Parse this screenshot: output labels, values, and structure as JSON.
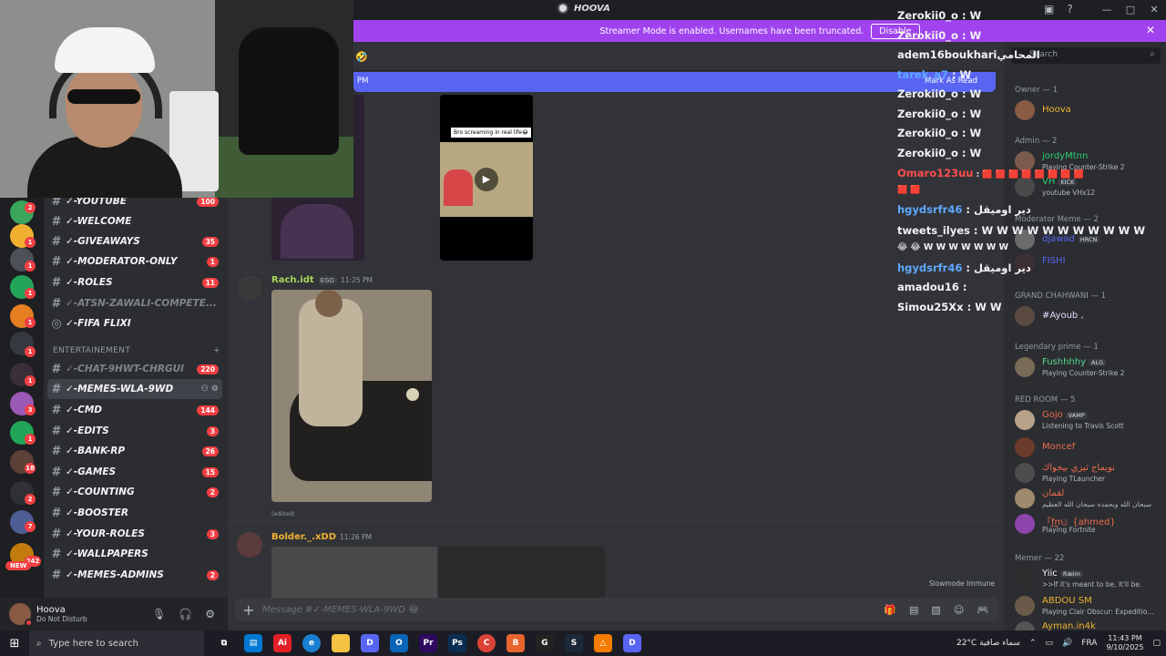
{
  "window": {
    "title": "HOOVA",
    "controls": [
      "—",
      "□",
      "✕"
    ],
    "top_icons": [
      "inbox-icon",
      "help-icon"
    ]
  },
  "banner": {
    "text": "Streamer Mode is enabled. Usernames have been truncated.",
    "button": "Disable",
    "close": "✕",
    "color": "#a043ee"
  },
  "servers": {
    "new_label": "NEW",
    "badges": [
      "2",
      "1",
      "1",
      "1",
      "1",
      "1",
      "1",
      "1",
      "3",
      "1",
      "18",
      "2",
      "7",
      "242"
    ]
  },
  "channels": [
    {
      "name": "✓-YOUTUBE",
      "badge": "100",
      "selected": false,
      "dim": false
    },
    {
      "name": "✓-WELCOME",
      "badge": "",
      "selected": false,
      "dim": false
    },
    {
      "name": "✓-GIVEAWAYS",
      "badge": "35",
      "selected": false,
      "dim": false
    },
    {
      "name": "✓-MODERATOR-ONLY",
      "badge": "1",
      "selected": false,
      "dim": false
    },
    {
      "name": "✓-ROLES",
      "badge": "11",
      "selected": false,
      "dim": false
    },
    {
      "name": "✓-ATSN-ZAWALI-COMPETE...",
      "badge": "",
      "selected": false,
      "dim": true
    },
    {
      "name": "✓-FIFA FLIXI",
      "badge": "",
      "selected": false,
      "dim": false
    },
    {
      "name": "✓-CHAT-9HWT-CHRGUI",
      "badge": "220",
      "selected": false,
      "dim": true
    },
    {
      "name": "✓-MEMES-WLA-9WD",
      "badge": "",
      "selected": true,
      "dim": false
    },
    {
      "name": "✓-CMD",
      "badge": "144",
      "selected": false,
      "dim": false
    },
    {
      "name": "✓-EDITS",
      "badge": "3",
      "selected": false,
      "dim": false
    },
    {
      "name": "✓-BANK-RP",
      "badge": "26",
      "selected": false,
      "dim": false
    },
    {
      "name": "✓-GAMES",
      "badge": "15",
      "selected": false,
      "dim": false
    },
    {
      "name": "✓-COUNTING",
      "badge": "2",
      "selected": false,
      "dim": false
    },
    {
      "name": "✓-BOOSTER",
      "badge": "",
      "selected": false,
      "dim": false
    },
    {
      "name": "✓-YOUR-ROLES",
      "badge": "3",
      "selected": false,
      "dim": false
    },
    {
      "name": "✓-WALLPAPERS",
      "badge": "",
      "selected": false,
      "dim": false
    },
    {
      "name": "✓-MEMES-ADMINS",
      "badge": "2",
      "selected": false,
      "dim": false
    }
  ],
  "category": {
    "name": "ENTERTAINEMENT",
    "add": "+"
  },
  "user": {
    "name": "Hoova",
    "status": "Do Not Disturb"
  },
  "main": {
    "new_messages_prefix": "PM",
    "mark_as_read": "Mark As Read",
    "video_caption": "Bro screaming in real life😂",
    "messages": [
      {
        "author": "Rach.idt",
        "tag": "EGO",
        "time": "11:25 PM",
        "edited": "(edited)"
      },
      {
        "author": "Bolder._.xDD",
        "tag": "",
        "time": "11:26 PM"
      }
    ],
    "slowmode": "Slowmode Immune"
  },
  "composer": {
    "placeholder": "Message #✓-MEMES-WLA-9WD 😂"
  },
  "stream_chat": [
    {
      "user": "Zerokii0_o",
      "text": "W",
      "color": "white"
    },
    {
      "user": "Zerokii0_o",
      "text": "W",
      "color": "white"
    },
    {
      "user": "adem16boukhari",
      "text": "المحامي",
      "color": "white"
    },
    {
      "user": "tarek_a7",
      "text": "W",
      "color": "blue"
    },
    {
      "user": "Zerokii0_o",
      "text": "W",
      "color": "white"
    },
    {
      "user": "Zerokii0_o",
      "text": "W",
      "color": "white"
    },
    {
      "user": "Zerokii0_o",
      "text": "W",
      "color": "white"
    },
    {
      "user": "Zerokii0_o",
      "text": "W",
      "color": "white"
    },
    {
      "user": "Omaro123uu",
      "text": "🟥 🟥 🟥 🟥 🟥 🟥 🟥 🟥",
      "color": "red"
    },
    {
      "user": "",
      "text": "🟥 🟥",
      "color": "white"
    },
    {
      "user": "hgydsrfr46",
      "text": "دير اوميقل",
      "color": "blue"
    },
    {
      "user": "tweets_ilyes",
      "text": "W W W W W W W W W W W",
      "color": "white"
    },
    {
      "user": "",
      "text": "😂 😂 W W W W W W W",
      "color": "white"
    },
    {
      "user": "hgydsrfr46",
      "text": "دير اوميقل",
      "color": "blue"
    },
    {
      "user": "amadou16",
      "text": "",
      "color": "white"
    },
    {
      "user": "Simou25Xx",
      "text": "W W",
      "color": "white"
    }
  ],
  "members": {
    "search_placeholder": "Search",
    "groups": [
      {
        "label": "Owner — 1",
        "members": [
          {
            "name": "Hoova",
            "sub": "",
            "tag": "",
            "color": "#f0b132",
            "avatar": "#8a5a44"
          }
        ]
      },
      {
        "label": "Admin — 2",
        "members": [
          {
            "name": "jordyMtnn",
            "sub": "Playing Counter-Strike 2",
            "tag": "",
            "color": "#2ecc71",
            "avatar": "#7b5b4b"
          },
          {
            "name": "VH",
            "sub": "youtube VHx12",
            "tag": "KICK",
            "color": "#2ecc71",
            "avatar": "#4a4a4a"
          }
        ]
      },
      {
        "label": "Moderator Meme — 2",
        "members": [
          {
            "name": "djawad",
            "sub": "",
            "tag": "HRCN",
            "color": "#5865f2",
            "avatar": "#6b6b6b"
          },
          {
            "name": "FISHI",
            "sub": "",
            "tag": "",
            "color": "#5865f2",
            "avatar": "#3d2f36"
          }
        ]
      },
      {
        "label": "GRAND CHAHWANI — 1",
        "members": [
          {
            "name": "#Ayoub ,",
            "sub": "",
            "tag": "",
            "color": "#e9d5ff",
            "avatar": "#5b4a3f"
          }
        ]
      },
      {
        "label": "Legendary prime — 1",
        "members": [
          {
            "name": "Fushhhhy",
            "sub": "Playing Counter-Strike 2",
            "tag": "ALG",
            "color": "#58d68d",
            "avatar": "#7a6b58"
          }
        ]
      },
      {
        "label": "RED ROOM — 5",
        "members": [
          {
            "name": "Gojo",
            "sub": "Listening to Travis Scott",
            "tag": "VAMP",
            "color": "#ed6b4c",
            "avatar": "#b8a28a"
          },
          {
            "name": "Moncef",
            "sub": "",
            "tag": "",
            "color": "#ed6b4c",
            "avatar": "#6a3a2a"
          },
          {
            "name": "نويماج ثيزي بيجواك",
            "sub": "Playing TLauncher",
            "tag": "",
            "color": "#ed6b4c",
            "avatar": "#4d4d4d"
          },
          {
            "name": "لقمان",
            "sub": "سبحان الله وبحمده سبحان الله العظيم",
            "tag": "",
            "color": "#ed6b4c",
            "avatar": "#a08a6e"
          },
          {
            "name": "『f͟m』{ahmed}",
            "sub": "Playing Fortnite",
            "tag": "",
            "color": "#ed6b4c",
            "avatar": "#8e44ad"
          }
        ]
      },
      {
        "label": "Memer — 22",
        "members": [
          {
            "name": "Yiic",
            "sub": ">>If it's meant to be, it'll be.",
            "tag": "Rælm",
            "color": "#f2f3f5",
            "avatar": "#2c2c2c"
          },
          {
            "name": "ABDOU SM",
            "sub": "Playing Clair Obscur: Expeditio...",
            "tag": "",
            "color": "#f0b132",
            "avatar": "#6a5a4a"
          },
          {
            "name": "Ayman.in4k",
            "sub": "",
            "tag": "",
            "color": "#f0b132",
            "avatar": "#555"
          }
        ]
      }
    ]
  },
  "taskbar": {
    "search_placeholder": "Type here to search",
    "apps": [
      "Ai",
      "e",
      "📁",
      "D",
      "O",
      "Pr",
      "Ps",
      "C",
      "B",
      "G",
      "S",
      "△",
      "D"
    ],
    "weather": "22°C سماء صافية",
    "lang": "FRA",
    "time": "11:43 PM",
    "date": "9/10/2025"
  }
}
